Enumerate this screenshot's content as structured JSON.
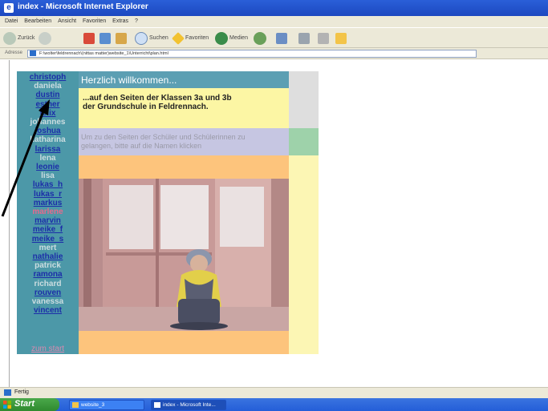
{
  "window": {
    "title": "index - Microsoft Internet Explorer",
    "menu": [
      "Datei",
      "Bearbeiten",
      "Ansicht",
      "Favoriten",
      "Extras",
      "?"
    ],
    "toolbar": {
      "back_label": "Zurück",
      "search_label": "Suchen",
      "favorites_label": "Favoriten",
      "media_label": "Medien"
    },
    "address": {
      "label": "Adresse",
      "value": "F:\\wolter\\feldrennach\\(nittas matter)website_1\\Unterricht\\plan.html"
    },
    "status_text": "Fertig"
  },
  "page": {
    "nav_items": [
      {
        "label": "christoph",
        "link": true
      },
      {
        "label": "daniela",
        "link": false
      },
      {
        "label": "dustin",
        "link": true
      },
      {
        "label": "esther",
        "link": true
      },
      {
        "label": "felix",
        "link": true
      },
      {
        "label": "johannes",
        "link": false
      },
      {
        "label": "joshua",
        "link": true
      },
      {
        "label": "katharina",
        "link": false
      },
      {
        "label": "larissa",
        "link": true
      },
      {
        "label": "lena",
        "link": false
      },
      {
        "label": "leonie",
        "link": true
      },
      {
        "label": "lisa",
        "link": false
      },
      {
        "label": "lukas_h",
        "link": true
      },
      {
        "label": "lukas_r",
        "link": true
      },
      {
        "label": "markus",
        "link": true
      },
      {
        "label": "marlene",
        "link": false,
        "active": true
      },
      {
        "label": "marvin",
        "link": true
      },
      {
        "label": "meike_f",
        "link": true
      },
      {
        "label": "meike_s",
        "link": true
      },
      {
        "label": "mert",
        "link": false
      },
      {
        "label": "nathalie",
        "link": true
      },
      {
        "label": "patrick",
        "link": false
      },
      {
        "label": "ramona",
        "link": true
      },
      {
        "label": "richard",
        "link": false
      },
      {
        "label": "rouven",
        "link": true
      },
      {
        "label": "vanessa",
        "link": false
      },
      {
        "label": "vincent",
        "link": true
      }
    ],
    "back_link": "zum start",
    "welcome_heading": "Herzlich willkommen...",
    "welcome_line1": "...auf den Seiten der Klassen 3a und 3b",
    "welcome_line2": "der Grundschule in Feldrennach.",
    "info_line1": "Um zu den Seiten der Schüler und Schülerinnen zu",
    "info_line2": "gelangen, bitte auf die Namen klicken"
  },
  "taskbar": {
    "start_label": "Start",
    "tasks": [
      "website_3",
      "index - Microsoft Inte..."
    ]
  },
  "colors": {
    "nav_bg": "#4c98a8",
    "heading_bg": "#5c9fb3",
    "welcome_bg": "#fcf6a4",
    "info_bg": "#c6c6e2",
    "orange": "#fdc47c",
    "green": "#9ed2aa"
  }
}
